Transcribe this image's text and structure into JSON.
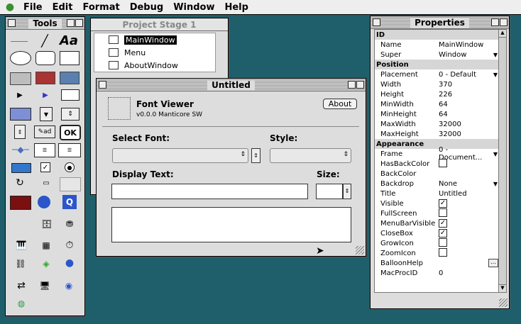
{
  "menubar": {
    "apple": "",
    "items": [
      "File",
      "Edit",
      "Format",
      "Debug",
      "Window",
      "Help"
    ]
  },
  "tools": {
    "title": "Tools"
  },
  "project": {
    "title": "Project Stage 1",
    "items": [
      "MainWindow",
      "Menu",
      "AboutWindow"
    ]
  },
  "untitled": {
    "title": "Untitled",
    "app_name": "Font Viewer",
    "version": "v0.0.0 Manticore SW",
    "about_label": "About",
    "select_font_label": "Select Font:",
    "style_label": "Style:",
    "display_text_label": "Display Text:",
    "size_label": "Size:"
  },
  "properties": {
    "title": "Properties",
    "rows": [
      {
        "section": "ID"
      },
      {
        "key": "Name",
        "value": "MainWindow"
      },
      {
        "key": "Super",
        "value": "Window",
        "dropdown": true
      },
      {
        "section": "Position"
      },
      {
        "key": "Placement",
        "value": "0 - Default",
        "dropdown": true
      },
      {
        "key": "Width",
        "value": "370"
      },
      {
        "key": "Height",
        "value": "226"
      },
      {
        "key": "MinWidth",
        "value": "64"
      },
      {
        "key": "MinHeight",
        "value": "64"
      },
      {
        "key": "MaxWidth",
        "value": "32000"
      },
      {
        "key": "MaxHeight",
        "value": "32000"
      },
      {
        "section": "Appearance"
      },
      {
        "key": "Frame",
        "value": "0 - Document...",
        "dropdown": true
      },
      {
        "key": "HasBackColor",
        "check": false
      },
      {
        "key": "BackColor",
        "value": ""
      },
      {
        "key": "Backdrop",
        "value": "None",
        "dropdown": true
      },
      {
        "key": "Title",
        "value": "Untitled"
      },
      {
        "key": "Visible",
        "check": true
      },
      {
        "key": "FullScreen",
        "check": false
      },
      {
        "key": "MenuBarVisible",
        "check": true
      },
      {
        "key": "CloseBox",
        "check": true
      },
      {
        "key": "GrowIcon",
        "check": false
      },
      {
        "key": "ZoomIcon",
        "check": false
      },
      {
        "key": "BalloonHelp",
        "value": ""
      },
      {
        "key": "MacProcID",
        "value": "0"
      }
    ]
  }
}
